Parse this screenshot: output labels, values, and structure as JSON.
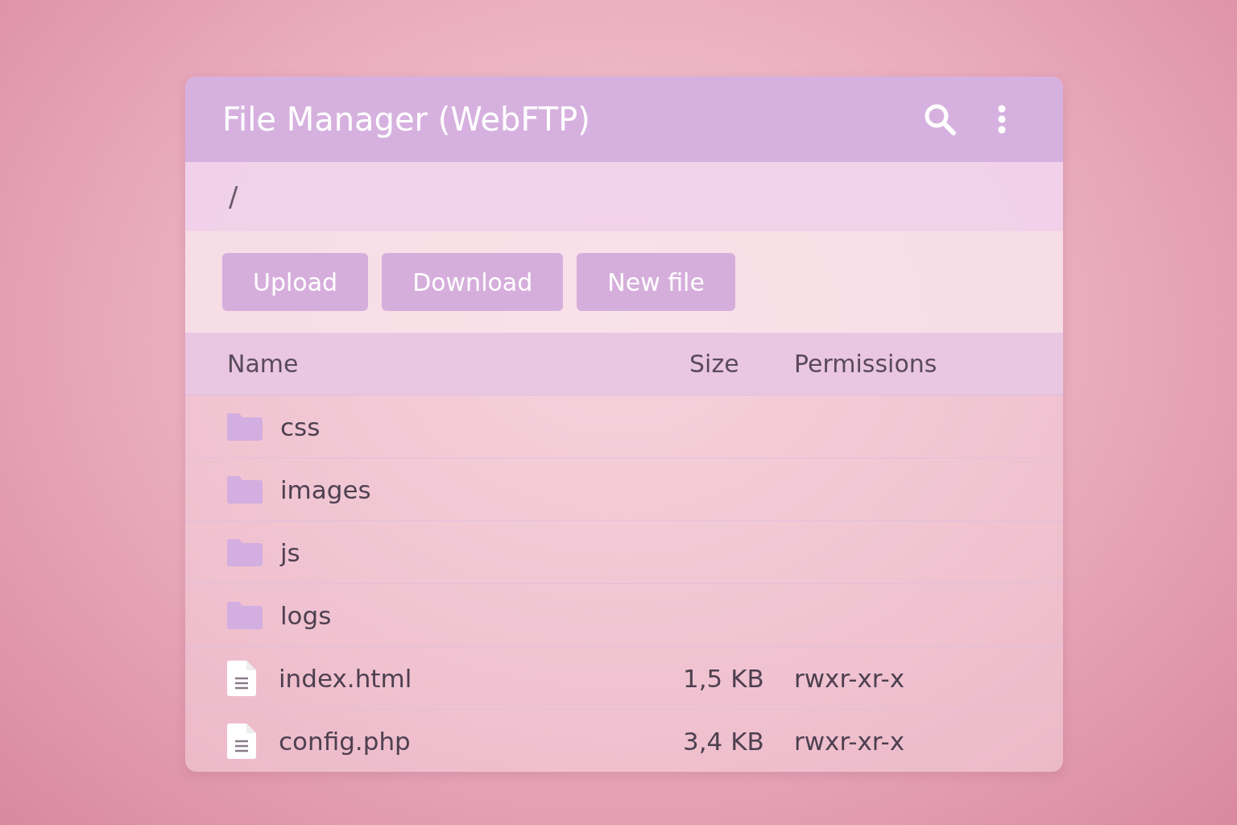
{
  "window": {
    "title": "File Manager (WebFTP)"
  },
  "path": "/",
  "buttons": [
    "Upload",
    "Download",
    "New file"
  ],
  "table": {
    "columns": [
      "Name",
      "Size",
      "Permissions"
    ],
    "rows": [
      {
        "kind": "folder",
        "name": "css"
      },
      {
        "kind": "folder",
        "name": "images"
      },
      {
        "kind": "folder",
        "name": "js"
      },
      {
        "kind": "folder",
        "name": "logs"
      },
      {
        "kind": "file",
        "name": "index.html",
        "size": "1,5 KB",
        "permissions": "rwxr-xr-x"
      },
      {
        "kind": "file",
        "name": "config.php",
        "size": "3,4 KB",
        "permissions": "rwxr-xr-x"
      }
    ]
  }
}
